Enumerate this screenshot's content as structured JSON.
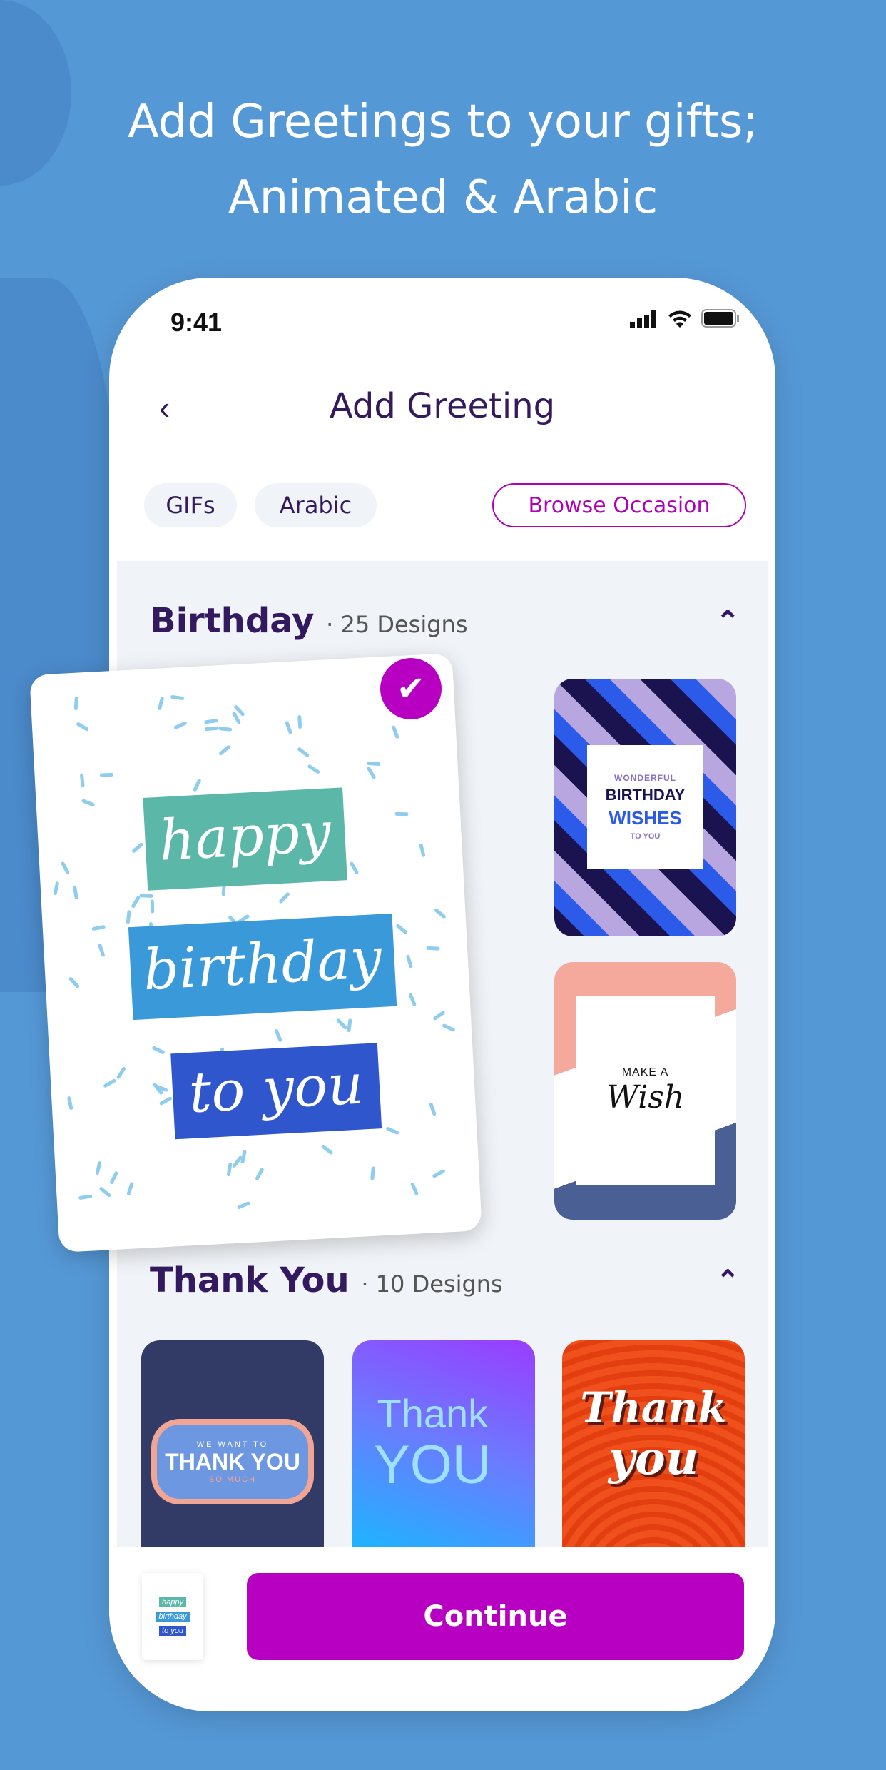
{
  "headline": {
    "line1": "Add Greetings to your gifts;",
    "line2": "Animated & Arabic"
  },
  "status": {
    "time": "9:41"
  },
  "header": {
    "title": "Add Greeting",
    "back_icon": "chevron-left-icon"
  },
  "filters": {
    "chips": [
      "GIFs",
      "Arabic"
    ],
    "browse": "Browse Occasion"
  },
  "sections": [
    {
      "title": "Birthday",
      "count": "· 25 Designs",
      "cards": [
        {
          "lines": [
            "happy",
            "birthday",
            "to you"
          ],
          "selected": true
        },
        {
          "lines": [
            "WONDERFUL",
            "BIRTHDAY",
            "WISHES",
            "TO YOU"
          ]
        },
        {
          "lines": [
            "MAKE A",
            "Wish"
          ]
        }
      ]
    },
    {
      "title": "Thank You",
      "count": "· 10 Designs",
      "cards": [
        {
          "lines": [
            "WE WANT TO",
            "THANK YOU",
            "SO MUCH"
          ]
        },
        {
          "lines": [
            "Thank",
            "YOU"
          ]
        },
        {
          "lines": [
            "Thank",
            "you"
          ]
        }
      ]
    }
  ],
  "footer": {
    "continue": "Continue",
    "thumb_lines": [
      "happy",
      "birthday",
      "to you"
    ]
  },
  "colors": {
    "background": "#5598d6",
    "accent": "#b800c2",
    "title": "#33195e"
  }
}
